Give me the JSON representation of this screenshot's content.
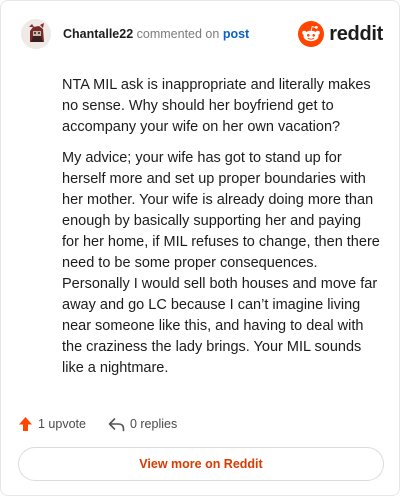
{
  "comment": {
    "username": "Chantalle22",
    "action_text": "commented on",
    "post_link": "post",
    "paragraphs": [
      "NTA MIL ask is inappropriate and literally makes no sense. Why should her boyfriend get to accompany your wife on her own vacation?",
      "My advice; your wife has got to stand up for herself more and set up proper boundaries with her mother. Your wife is already doing more than enough by basically supporting her and paying for her home, if MIL refuses to change, then there need to be some proper consequences. Personally I would sell both houses and move far away and go LC because I can’t imagine living near someone like this, and having to deal with the craziness the lady brings. Your MIL sounds like a nightmare."
    ]
  },
  "brand": {
    "name": "reddit",
    "color": "#ff4500"
  },
  "actions": {
    "upvotes": "1 upvote",
    "replies": "0 replies"
  },
  "footer": {
    "view_more": "View more on Reddit"
  },
  "colors": {
    "link": "#0a61c9",
    "upvote": "#ff4500",
    "view_more": "#d93a00"
  },
  "icons": [
    "avatar",
    "reddit-snoo-icon",
    "upvote-arrow-icon",
    "reply-arrow-icon"
  ]
}
